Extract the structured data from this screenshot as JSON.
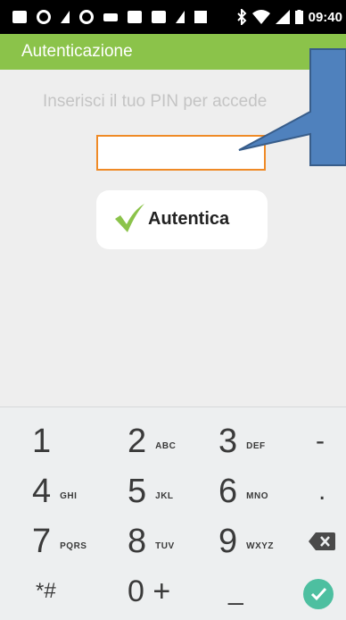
{
  "status_bar": {
    "time": "09:40",
    "icons": [
      "message-icon",
      "sync-icon",
      "app-icon",
      "phone-icon",
      "keyboard-icon",
      "chat-icon",
      "image-icon",
      "missed-call-icon",
      "square-icon",
      "bluetooth-icon",
      "wifi-icon",
      "signal-icon",
      "battery-icon"
    ]
  },
  "app_bar": {
    "title": "Autenticazione"
  },
  "main": {
    "prompt": "Inserisci il tuo PIN per accede",
    "pin_value": "",
    "auth_button_label": "Autentica",
    "auth_icon": "checkmark-icon"
  },
  "keyboard": {
    "rows": [
      [
        {
          "num": "1",
          "sub": ""
        },
        {
          "num": "2",
          "sub": "ABC"
        },
        {
          "num": "3",
          "sub": "DEF"
        },
        {
          "num": "-",
          "sub": ""
        }
      ],
      [
        {
          "num": "4",
          "sub": "GHI"
        },
        {
          "num": "5",
          "sub": "JKL"
        },
        {
          "num": "6",
          "sub": "MNO"
        },
        {
          "num": ".",
          "sub": ""
        }
      ],
      [
        {
          "num": "7",
          "sub": "PQRS"
        },
        {
          "num": "8",
          "sub": "TUV"
        },
        {
          "num": "9",
          "sub": "WXYZ"
        },
        {
          "num": "",
          "sub": ""
        }
      ],
      [
        {
          "num": "*#",
          "sub": ""
        },
        {
          "num": "0 +",
          "sub": ""
        },
        {
          "num": "_",
          "sub": ""
        },
        {
          "num": "",
          "sub": ""
        }
      ]
    ],
    "backspace_icon": "backspace-icon",
    "done_icon": "checkmark-icon"
  },
  "colors": {
    "accent": "#8bc34a",
    "field_border": "#ef8a26",
    "callout_fill": "#4f81bd",
    "done_button": "#4dbfa0"
  }
}
